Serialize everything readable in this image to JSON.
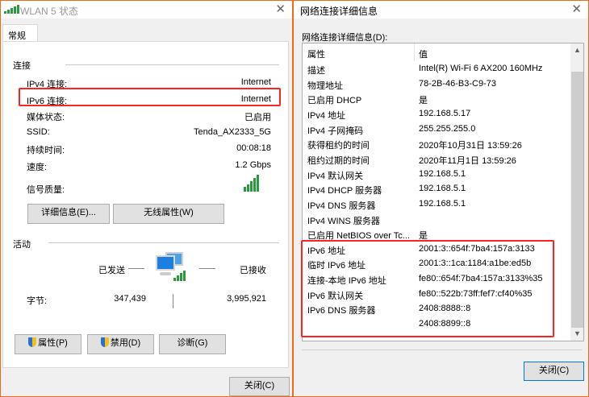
{
  "status_window": {
    "title": "WLAN 5 状态",
    "tab": "常规",
    "connection_section": "连接",
    "fields": [
      {
        "label": "IPv4 连接:",
        "value": "Internet"
      },
      {
        "label": "IPv6 连接:",
        "value": "Internet"
      },
      {
        "label": "媒体状态:",
        "value": "已启用"
      },
      {
        "label": "SSID:",
        "value": "Tenda_AX2333_5G"
      },
      {
        "label": "持续时间:",
        "value": "00:08:18"
      },
      {
        "label": "速度:",
        "value": "1.2 Gbps"
      }
    ],
    "signal_label": "信号质量:",
    "signal_bars": 5,
    "details_button": "详细信息(E)...",
    "wireless_button": "无线属性(W)",
    "activity_section": "活动",
    "sent_label": "已发送",
    "received_label": "已接收",
    "bytes_label": "字节:",
    "bytes_sent": "347,439",
    "bytes_received": "3,995,921",
    "properties_button": "属性(P)",
    "disable_button": "禁用(D)",
    "diagnose_button": "诊断(G)",
    "close_button": "关闭(C)"
  },
  "details_window": {
    "title": "网络连接详细信息",
    "list_label": "网络连接详细信息(D):",
    "col_property": "属性",
    "col_value": "值",
    "rows": [
      {
        "p": "描述",
        "v": "Intel(R) Wi-Fi 6 AX200 160MHz"
      },
      {
        "p": "物理地址",
        "v": "78-2B-46-B3-C9-73"
      },
      {
        "p": "已启用 DHCP",
        "v": "是"
      },
      {
        "p": "IPv4 地址",
        "v": "192.168.5.17"
      },
      {
        "p": "IPv4 子网掩码",
        "v": "255.255.255.0"
      },
      {
        "p": "获得租约的时间",
        "v": "2020年10月31日 13:59:26"
      },
      {
        "p": "租约过期的时间",
        "v": "2020年11月1日 13:59:26"
      },
      {
        "p": "IPv4 默认网关",
        "v": "192.168.5.1"
      },
      {
        "p": "IPv4 DHCP 服务器",
        "v": "192.168.5.1"
      },
      {
        "p": "IPv4 DNS 服务器",
        "v": "192.168.5.1"
      },
      {
        "p": "IPv4 WINS 服务器",
        "v": ""
      },
      {
        "p": "已启用 NetBIOS over Tc...",
        "v": "是"
      },
      {
        "p": "IPv6 地址",
        "v": "2001:3::654f:7ba4:157a:3133"
      },
      {
        "p": "临时 IPv6 地址",
        "v": "2001:3::1ca:1184:a1be:ed5b"
      },
      {
        "p": "连接-本地 IPv6 地址",
        "v": "fe80::654f:7ba4:157a:3133%35"
      },
      {
        "p": "IPv6 默认网关",
        "v": "fe80::522b:73ff:fef7:cf40%35"
      },
      {
        "p": "IPv6 DNS 服务器",
        "v": "2408:8888::8"
      },
      {
        "p": "",
        "v": "2408:8899::8"
      }
    ],
    "close_button": "关闭(C)"
  }
}
